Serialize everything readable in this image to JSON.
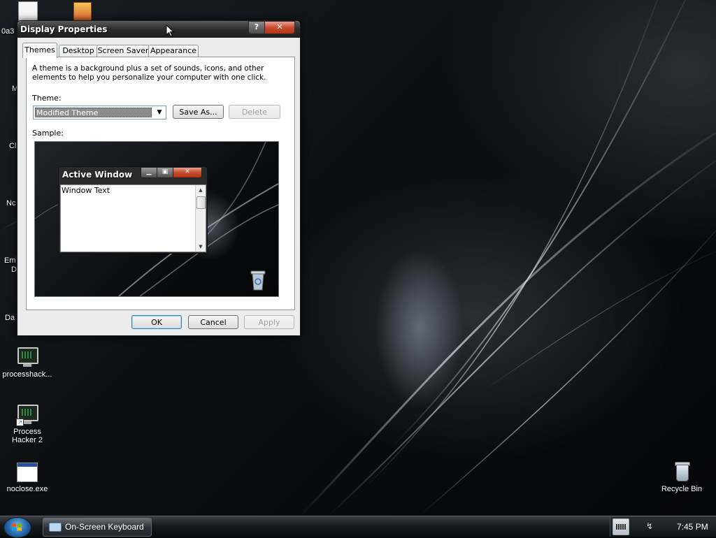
{
  "desktop": {
    "icons": [
      {
        "label": "processhack..."
      },
      {
        "label": "Process Hacker 2"
      },
      {
        "label": "noclose.exe"
      },
      {
        "label": "Recycle Bin"
      }
    ],
    "cut_labels": [
      "0a3",
      "M",
      "Cl",
      "Nc",
      "Em",
      "D",
      "Da"
    ]
  },
  "dialog": {
    "title": "Display Properties",
    "help_button": "?",
    "close_button": "✕",
    "tabs": [
      {
        "label": "Themes",
        "active": true
      },
      {
        "label": "Desktop"
      },
      {
        "label": "Screen Saver"
      },
      {
        "label": "Appearance"
      }
    ],
    "description": "A theme is a background plus a set of sounds, icons, and other elements to help you personalize your computer with one click.",
    "theme_label": "Theme:",
    "theme_value": "Modified Theme",
    "save_as": "Save As...",
    "delete": "Delete",
    "sample_label": "Sample:",
    "sample_window": {
      "title": "Active Window",
      "text": "Window Text"
    },
    "ok": "OK",
    "cancel": "Cancel",
    "apply": "Apply"
  },
  "taskbar": {
    "tasks": [
      {
        "label": "On-Screen Keyboard"
      }
    ],
    "clock": "7:45 PM"
  },
  "colors": {
    "close_red": "#c94b2f",
    "titlebar": "#2c2c2c",
    "ok_border": "#3c7fb1"
  }
}
